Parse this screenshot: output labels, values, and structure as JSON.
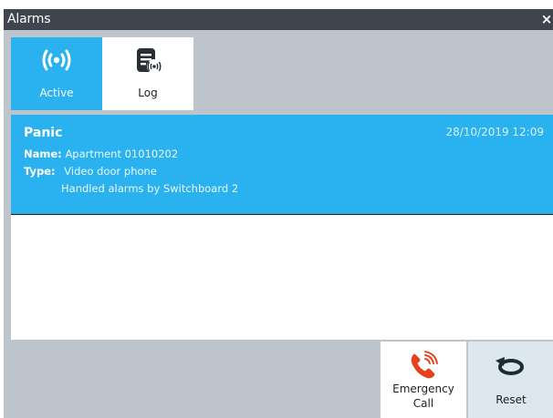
{
  "window": {
    "title": "Alarms",
    "close_glyph": "×"
  },
  "tabs": [
    {
      "label": "Active",
      "icon": "alarm-signal-icon",
      "selected": true
    },
    {
      "label": "Log",
      "icon": "log-document-icon",
      "selected": false
    }
  ],
  "alarm": {
    "title": "Panic",
    "date": "28/10/2019 12:09",
    "name_label": "Name:",
    "name_value": "Apartment  01010202",
    "type_label": "Type:",
    "type_value": "Video door phone",
    "extra": "Handled alarms by Switchboard 2"
  },
  "actions": {
    "emergency_line1": "Emergency",
    "emergency_line2": "Call",
    "reset_label": "Reset"
  },
  "colors": {
    "accent": "#2ab2f0",
    "titlebar": "#3f454e",
    "background": "#bdc4cc",
    "phone_icon": "#e8401c",
    "reset_icon": "#1f2b33"
  }
}
